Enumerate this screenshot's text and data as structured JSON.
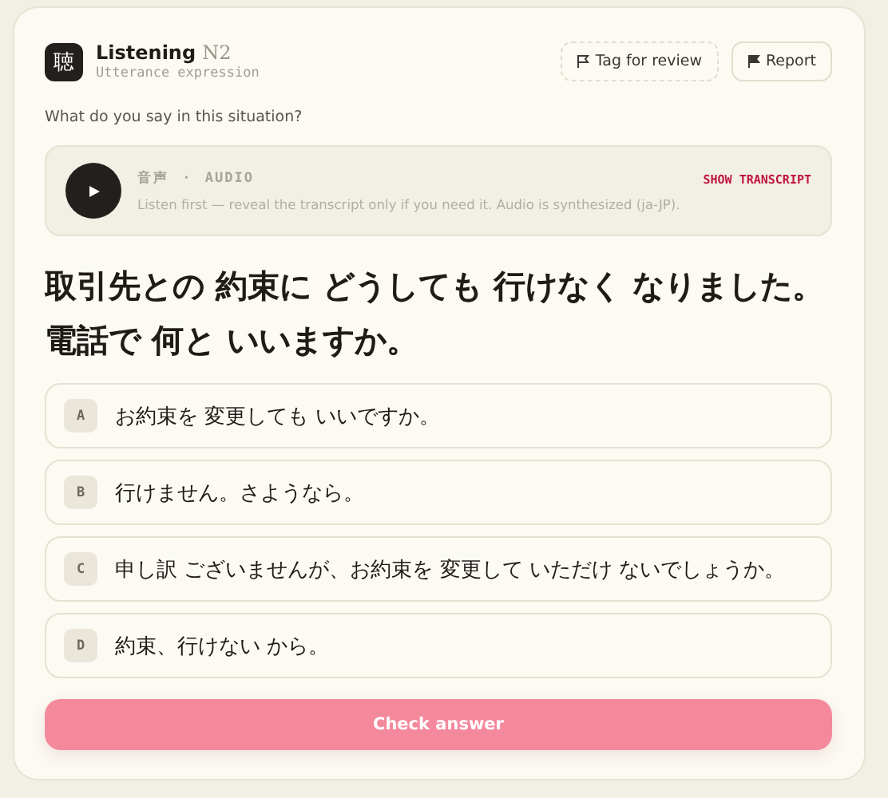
{
  "header": {
    "icon_glyph": "聴",
    "title": "Listening",
    "level": "N2",
    "subtitle": "Utterance expression"
  },
  "actions": [
    {
      "label": "Tag for review",
      "kind": "tag"
    },
    {
      "label": "Report",
      "kind": "report"
    }
  ],
  "prompt": "What do you say in this situation?",
  "audio": {
    "label_jp": "音声",
    "separator": "·",
    "label": "AUDIO",
    "note": "Listen first — reveal the transcript only if you need it. Audio is synthesized (ja-JP).",
    "transcript_link": "SHOW TRANSCRIPT"
  },
  "question": "取引先との 約束に どうしても 行けなく なりました。電話で 何と いいますか。",
  "options": [
    {
      "letter": "A",
      "text": "お約束を 変更しても いいですか。",
      "selected": false
    },
    {
      "letter": "B",
      "text": "行けません。さようなら。",
      "selected": false
    },
    {
      "letter": "C",
      "text": "申し訳 ございませんが、お約束を 変更して いただけ ないでしょうか。",
      "selected": false
    },
    {
      "letter": "D",
      "text": "約束、行けない から。",
      "selected": false
    }
  ],
  "submit": {
    "label": "Check answer",
    "disabled": true
  }
}
